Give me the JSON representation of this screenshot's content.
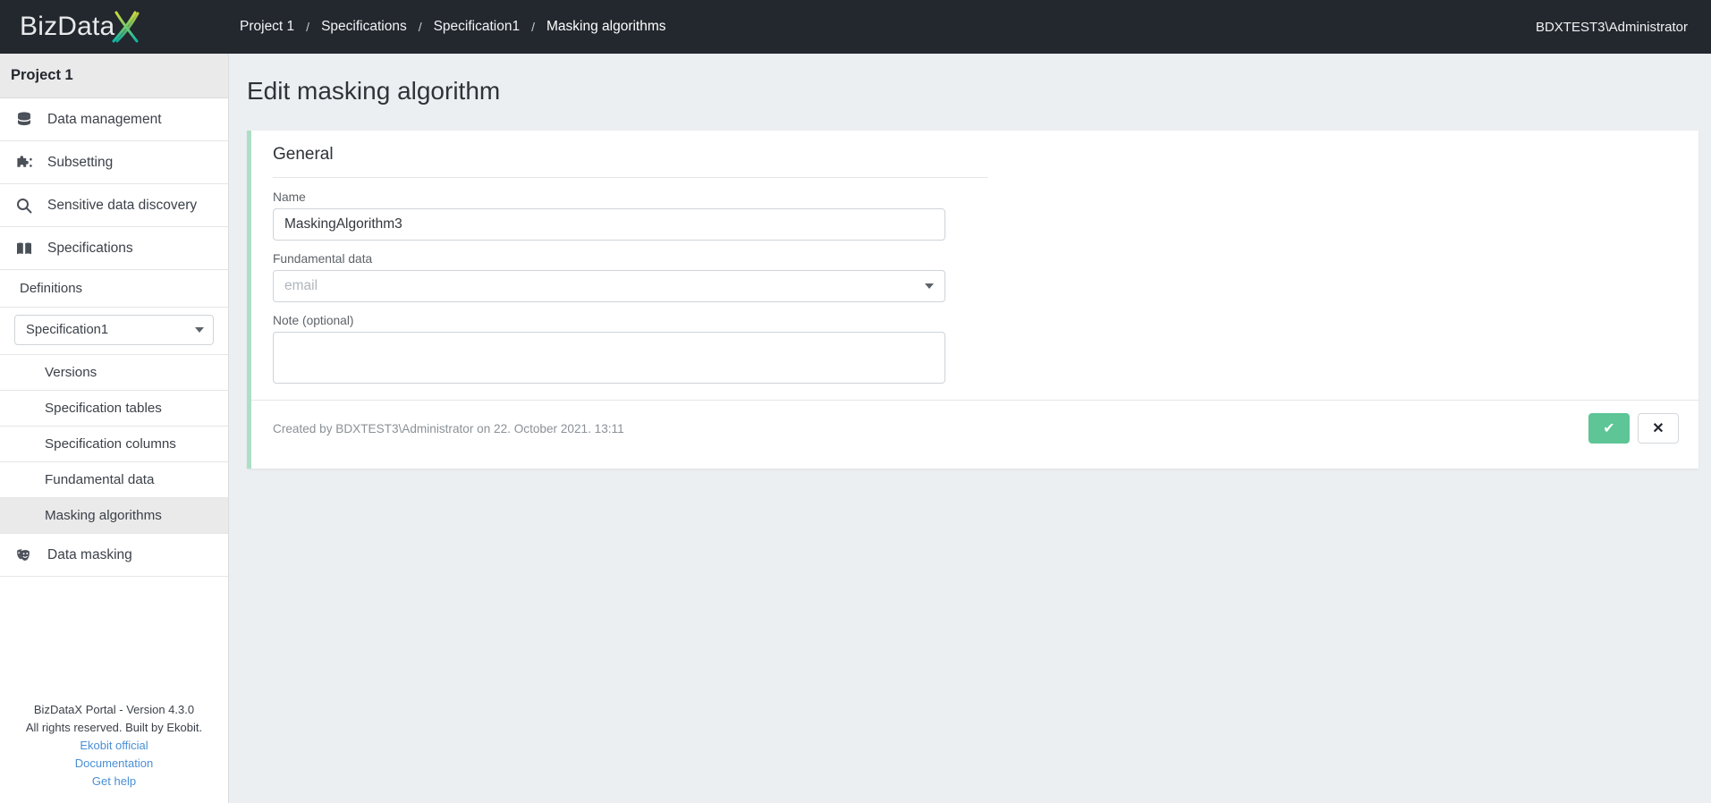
{
  "app": {
    "logo_text": "BizData",
    "logo_mark": "X"
  },
  "topbar": {
    "breadcrumb": [
      {
        "label": "Project 1",
        "sep": "/"
      },
      {
        "label": "Specifications",
        "sep": "/"
      },
      {
        "label": "Specification1",
        "sep": "/"
      },
      {
        "label": "Masking algorithms",
        "sep": ""
      }
    ],
    "user": "BDXTEST3\\Administrator"
  },
  "sidebar": {
    "project_title": "Project 1",
    "items": [
      {
        "label": "Data management",
        "icon": "database-icon"
      },
      {
        "label": "Subsetting",
        "icon": "puzzle-piece-icon"
      },
      {
        "label": "Sensitive data discovery",
        "icon": "magnifier-icon"
      },
      {
        "label": "Specifications",
        "icon": "book-icon"
      }
    ],
    "definitions_label": "Definitions",
    "spec_select_value": "Specification1",
    "sub_items": [
      {
        "label": "Versions",
        "active": false
      },
      {
        "label": "Specification tables",
        "active": false
      },
      {
        "label": "Specification columns",
        "active": false
      },
      {
        "label": "Fundamental data",
        "active": false
      },
      {
        "label": "Masking algorithms",
        "active": true
      }
    ],
    "data_masking": {
      "label": "Data masking",
      "icon": "theater-masks-icon"
    },
    "footer": {
      "line1": "BizDataX Portal - Version 4.3.0",
      "line2": "All rights reserved. Built by Ekobit.",
      "link1": "Ekobit official",
      "link2": "Documentation",
      "link3": "Get help"
    }
  },
  "main": {
    "page_title": "Edit masking algorithm",
    "card": {
      "section_title": "General",
      "fields": {
        "name_label": "Name",
        "name_value": "MaskingAlgorithm3",
        "fundamental_label": "Fundamental data",
        "fundamental_placeholder": "email",
        "note_label": "Note (optional)",
        "note_value": ""
      },
      "created_by": "Created by BDXTEST3\\Administrator on 22. October 2021. 13:11",
      "confirm_label": "✔",
      "cancel_label": "✕"
    }
  },
  "colors": {
    "topbar_bg": "#23272e",
    "accent_green": "#5dc596",
    "card_border_green": "#aedfc6",
    "page_bg": "#eceff1",
    "link_blue": "#4a8fd6"
  }
}
